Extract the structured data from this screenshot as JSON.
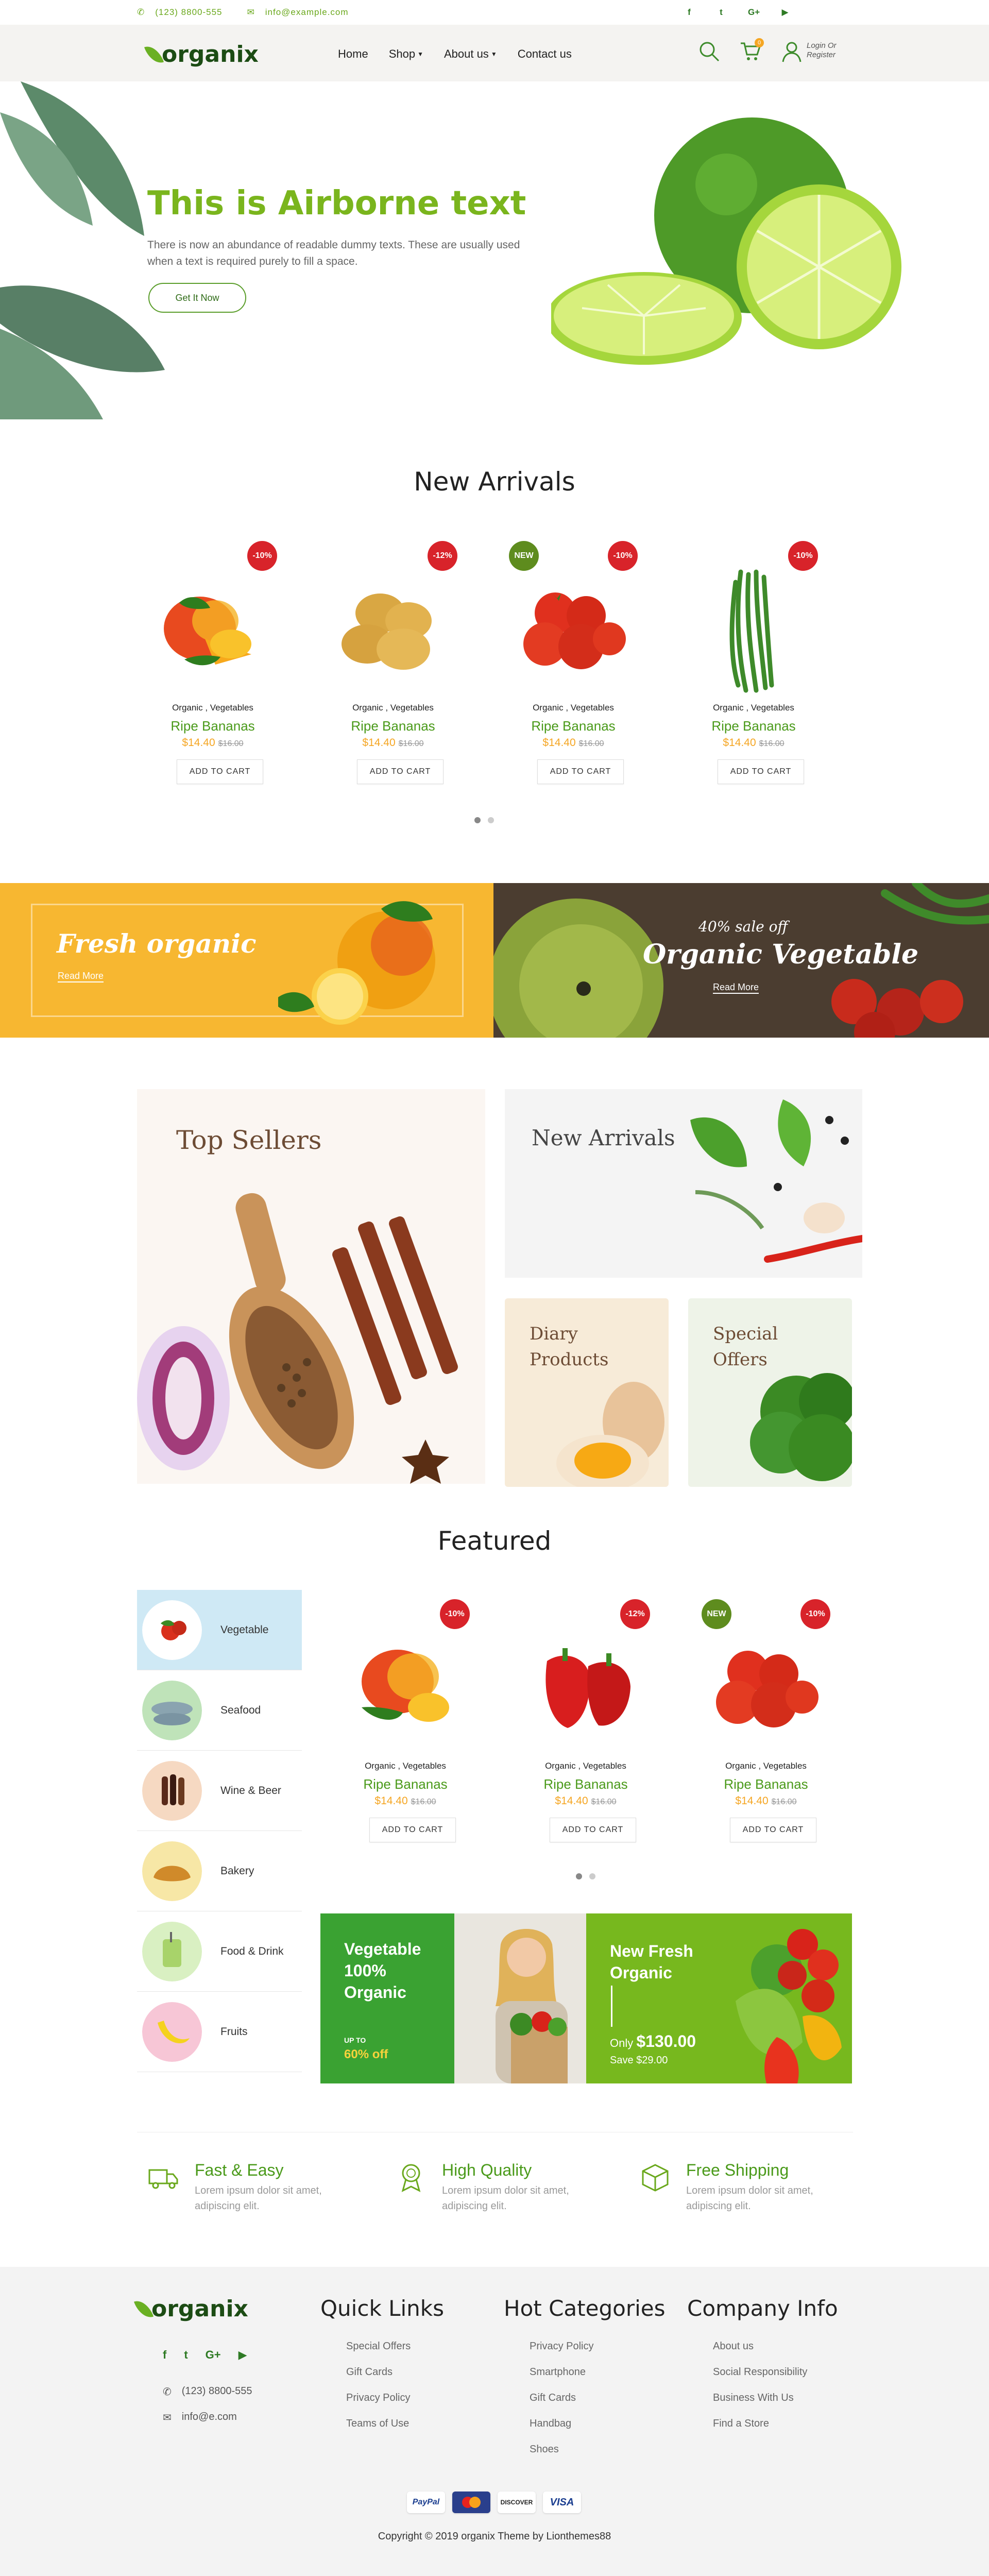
{
  "topbar": {
    "phone": "(123) 8800-555",
    "email": "info@example.com",
    "social": [
      "f",
      "t",
      "G+",
      "▶"
    ]
  },
  "header": {
    "logo": "organix",
    "nav": [
      {
        "label": "Home",
        "dropdown": false
      },
      {
        "label": "Shop",
        "dropdown": true
      },
      {
        "label": "About us",
        "dropdown": true
      },
      {
        "label": "Contact us",
        "dropdown": false
      }
    ],
    "cart_count": "0",
    "login_line1": "Login Or",
    "login_line2": "Register"
  },
  "hero": {
    "title": "This is Airborne text",
    "text": "There is now an abundance of readable dummy texts. These are usually used when a text is required purely to fill a space.",
    "button": "Get It Now"
  },
  "new_arrivals": {
    "title": "New Arrivals",
    "products": [
      {
        "badge": "-10%",
        "badge_color": "red",
        "category": "Organic , Vegetables",
        "name": "Ripe Bananas",
        "price": "$14.40",
        "old_price": "$16.00",
        "button": "ADD TO CART",
        "image": "mango"
      },
      {
        "badge": "-12%",
        "badge_color": "red",
        "category": "Organic , Vegetables",
        "name": "Ripe Bananas",
        "price": "$14.40",
        "old_price": "$16.00",
        "button": "ADD TO CART",
        "image": "potato"
      },
      {
        "badge": "-10%",
        "badge_color": "red",
        "badge2": "NEW",
        "category": "Organic , Vegetables",
        "name": "Ripe Bananas",
        "price": "$14.40",
        "old_price": "$16.00",
        "button": "ADD TO CART",
        "image": "tomato"
      },
      {
        "badge": "-10%",
        "badge_color": "red",
        "category": "Organic , Vegetables",
        "name": "Ripe Bananas",
        "price": "$14.40",
        "old_price": "$16.00",
        "button": "ADD TO CART",
        "image": "beans"
      }
    ]
  },
  "promo_banners": [
    {
      "title": "Fresh organic",
      "link": "Read More",
      "bg": "#f7b731"
    },
    {
      "eyebrow": "40% sale off",
      "title": "Organic Vegetable",
      "link": "Read More",
      "bg": "#5a4a3a"
    }
  ],
  "category_tiles": {
    "top_sellers": "Top Sellers",
    "new_arrivals": "New Arrivals",
    "diary_line1": "Diary",
    "diary_line2": "Products",
    "special_line1": "Special",
    "special_line2": "Offers"
  },
  "featured": {
    "title": "Featured",
    "categories": [
      {
        "label": "Vegetable",
        "active": true
      },
      {
        "label": "Seafood",
        "active": false
      },
      {
        "label": "Wine & Beer",
        "active": false
      },
      {
        "label": "Bakery",
        "active": false
      },
      {
        "label": "Food & Drink",
        "active": false
      },
      {
        "label": "Fruits",
        "active": false
      }
    ],
    "products": [
      {
        "badge": "-10%",
        "category": "Organic , Vegetables",
        "name": "Ripe Bananas",
        "price": "$14.40",
        "old_price": "$16.00",
        "button": "ADD TO CART",
        "image": "mango"
      },
      {
        "badge": "-12%",
        "category": "Organic , Vegetables",
        "name": "Ripe Bananas",
        "price": "$14.40",
        "old_price": "$16.00",
        "button": "ADD TO CART",
        "image": "pepper"
      },
      {
        "badge": "-10%",
        "badge2": "NEW",
        "category": "Organic , Vegetables",
        "name": "Ripe Bananas",
        "price": "$14.40",
        "old_price": "$16.00",
        "button": "ADD TO CART",
        "image": "tomato"
      }
    ],
    "banner_left": {
      "line1": "Vegetable",
      "line2": "100%",
      "line3": "Organic",
      "upto": "UP TO",
      "off": "60% off"
    },
    "banner_right": {
      "line1": "New Fresh",
      "line2": "Organic",
      "only": "Only",
      "price": "$130.00",
      "save": "Save $29.00"
    }
  },
  "features": [
    {
      "title": "Fast & Easy",
      "desc": "Lorem ipsum dolor sit amet, adipiscing elit.",
      "icon": "truck-icon"
    },
    {
      "title": "High Quality",
      "desc": "Lorem ipsum dolor sit amet, adipiscing elit.",
      "icon": "award-icon"
    },
    {
      "title": "Free Shipping",
      "desc": "Lorem ipsum dolor sit amet, adipiscing elit.",
      "icon": "box-icon"
    }
  ],
  "footer": {
    "logo": "organix",
    "social": [
      "f",
      "t",
      "G+",
      "▶"
    ],
    "phone": "(123) 8800-555",
    "email": "info@e.com",
    "quick_links": {
      "title": "Quick Links",
      "items": [
        "Special Offers",
        "Gift Cards",
        "Privacy Policy",
        "Teams of Use"
      ]
    },
    "hot_categories": {
      "title": "Hot Categories",
      "items": [
        "Privacy Policy",
        "Smartphone",
        "Gift Cards",
        "Handbag",
        "Shoes"
      ]
    },
    "company_info": {
      "title": "Company Info",
      "items": [
        "About us",
        "Social Responsibility",
        "Business With Us",
        "Find a Store"
      ]
    },
    "payments": [
      "PayPal",
      "MC",
      "DISCOVER",
      "VISA"
    ],
    "copyright": "Copyright © 2019 organix Theme by Lionthemes88"
  }
}
